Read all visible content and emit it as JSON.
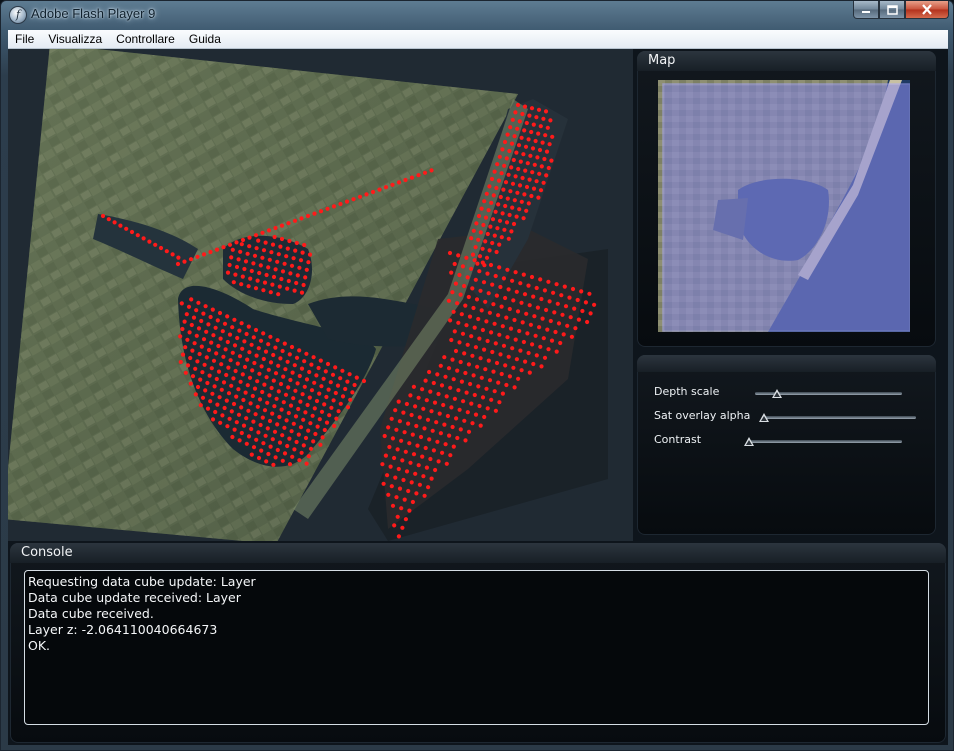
{
  "window": {
    "title": "Adobe Flash Player 9"
  },
  "titlebar_buttons": {
    "minimize": "minimize-icon",
    "maximize": "maximize-icon",
    "close": "close-icon"
  },
  "menu": {
    "items": [
      "File",
      "Visualizza",
      "Controllare",
      "Guida"
    ]
  },
  "map_panel": {
    "title": "Map",
    "overlay_color": "#8c8cf0"
  },
  "controls": {
    "sliders": [
      {
        "label": "Depth scale",
        "value": 0.15
      },
      {
        "label": "Sat overlay alpha",
        "value": 0.0
      },
      {
        "label": "Contrast",
        "value": 0.0
      }
    ]
  },
  "console": {
    "title": "Console",
    "lines": [
      "Requesting data cube update: Layer",
      "Data cube update received: Layer",
      "Data cube received.",
      "Layer z: -2.064110040664673",
      "OK."
    ]
  },
  "colors": {
    "data_point": "#ff1a1a",
    "accent_blue": "#6a6af5"
  }
}
